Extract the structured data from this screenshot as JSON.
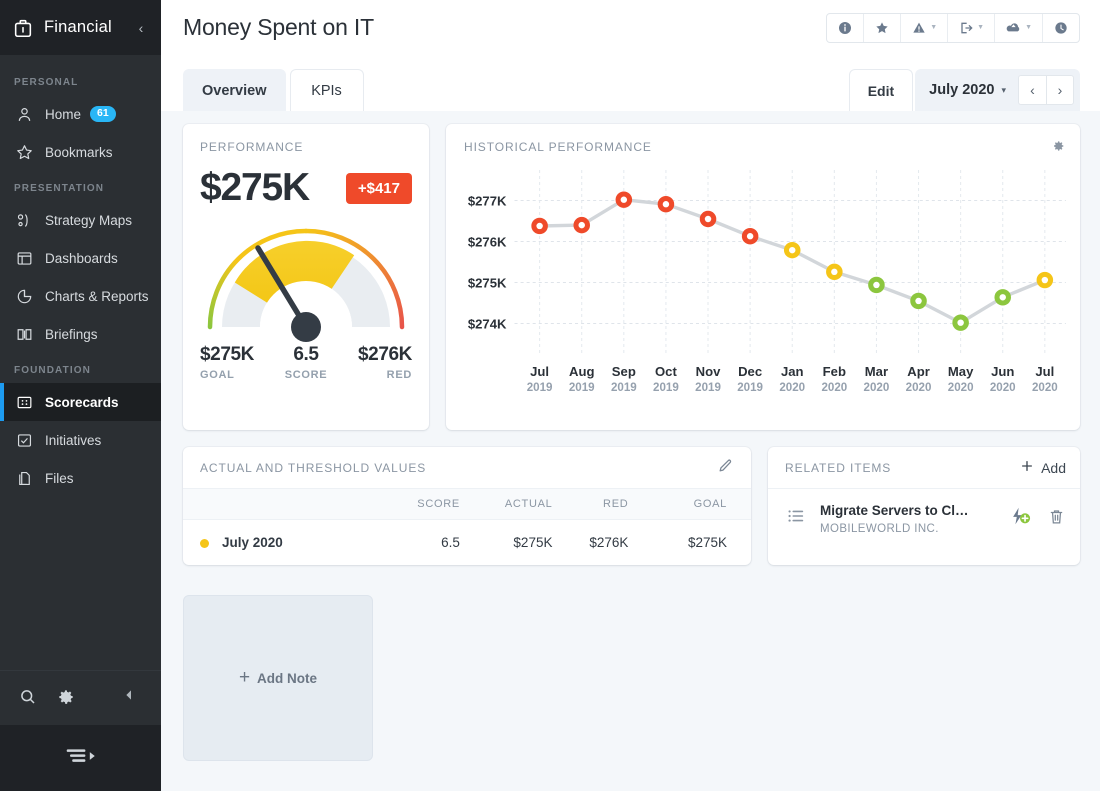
{
  "sidebar": {
    "brand": {
      "label": "Financial",
      "icon": "briefcase-icon",
      "collapse_icon": "chevron-left-icon"
    },
    "sections": [
      {
        "label": "PERSONAL",
        "items": [
          {
            "label": "Home",
            "icon": "user-icon",
            "badge": "61",
            "active": false
          },
          {
            "label": "Bookmarks",
            "icon": "star-outline-icon",
            "badge": "",
            "active": false
          }
        ]
      },
      {
        "label": "PRESENTATION",
        "items": [
          {
            "label": "Strategy Maps",
            "icon": "strategy-map-icon",
            "badge": "",
            "active": false
          },
          {
            "label": "Dashboards",
            "icon": "dashboard-icon",
            "badge": "",
            "active": false
          },
          {
            "label": "Charts & Reports",
            "icon": "pie-chart-icon",
            "badge": "",
            "active": false
          },
          {
            "label": "Briefings",
            "icon": "book-icon",
            "badge": "",
            "active": false
          }
        ]
      },
      {
        "label": "FOUNDATION",
        "items": [
          {
            "label": "Scorecards",
            "icon": "scorecard-icon",
            "badge": "",
            "active": true
          },
          {
            "label": "Initiatives",
            "icon": "checkbox-icon",
            "badge": "",
            "active": false
          },
          {
            "label": "Files",
            "icon": "file-icon",
            "badge": "",
            "active": false
          }
        ]
      }
    ],
    "footer": {
      "search_icon": "search-icon",
      "settings_icon": "gear-icon",
      "collapse_icon": "caret-left-icon"
    },
    "bottom_bar": {
      "icon": "menu-expand-icon"
    }
  },
  "header": {
    "title": "Money Spent on IT",
    "tools": [
      {
        "name": "info-icon",
        "caret": false
      },
      {
        "name": "star-icon",
        "caret": false
      },
      {
        "name": "alert-icon",
        "caret": true
      },
      {
        "name": "export-icon",
        "caret": true
      },
      {
        "name": "cloud-upload-icon",
        "caret": true
      },
      {
        "name": "history-clock-icon",
        "caret": false
      }
    ]
  },
  "tabs": [
    {
      "label": "Overview",
      "active": true
    },
    {
      "label": "KPIs",
      "active": false
    }
  ],
  "toolbar": {
    "edit_label": "Edit",
    "period_label": "July 2020",
    "period_caret": "▾",
    "prev_label": "‹",
    "next_label": "›"
  },
  "performance": {
    "card_title": "PERFORMANCE",
    "value": "$275K",
    "delta": "+$417",
    "delta_color": "#ef4a2a",
    "gauge": {
      "needle_value": 6.5,
      "band_colors": {
        "green": "#a5cd39",
        "yellow": "#f5c518",
        "red": "#e8544a"
      }
    },
    "stats": [
      {
        "value": "$275K",
        "label": "GOAL"
      },
      {
        "value": "6.5",
        "label": "SCORE"
      },
      {
        "value": "$276K",
        "label": "RED"
      }
    ]
  },
  "chart_card": {
    "title": "HISTORICAL PERFORMANCE",
    "gear_icon": "gear-icon"
  },
  "chart_data": {
    "type": "line",
    "title": "Historical Performance",
    "xlabel": "",
    "ylabel": "",
    "ylim": [
      273.5,
      277.55
    ],
    "yticks": [
      277,
      276,
      275,
      274
    ],
    "ytick_labels": [
      "$277K",
      "$276K",
      "$275K",
      "$274K"
    ],
    "grid": true,
    "legend": "none",
    "categories": [
      "Jul 2019",
      "Aug 2019",
      "Sep 2019",
      "Oct 2019",
      "Nov 2019",
      "Dec 2019",
      "Jan 2020",
      "Feb 2020",
      "Mar 2020",
      "Apr 2020",
      "May 2020",
      "Jun 2020",
      "Jul 2020"
    ],
    "category_months": [
      "Jul",
      "Aug",
      "Sep",
      "Oct",
      "Nov",
      "Dec",
      "Jan",
      "Feb",
      "Mar",
      "Apr",
      "May",
      "Jun",
      "Jul"
    ],
    "category_years": [
      "2019",
      "2019",
      "2019",
      "2019",
      "2019",
      "2019",
      "2020",
      "2020",
      "2020",
      "2020",
      "2020",
      "2020",
      "2020"
    ],
    "series": [
      {
        "name": "Actual",
        "values": [
          276.38,
          276.4,
          277.02,
          276.91,
          276.55,
          276.13,
          275.79,
          275.26,
          274.94,
          274.55,
          274.02,
          274.64,
          275.06
        ],
        "point_colors": [
          "#ef4a2a",
          "#ef4a2a",
          "#ef4a2a",
          "#ef4a2a",
          "#ef4a2a",
          "#ef4a2a",
          "#f5c518",
          "#f5c518",
          "#8cc63e",
          "#8cc63e",
          "#8cc63e",
          "#8cc63e",
          "#f5c518"
        ],
        "line_color": "#d2d6da"
      }
    ]
  },
  "values_table": {
    "title": "ACTUAL AND THRESHOLD VALUES",
    "edit_icon": "pencil-icon",
    "columns": [
      "",
      "SCORE",
      "ACTUAL",
      "RED",
      "GOAL"
    ],
    "rows": [
      {
        "period": "July 2020",
        "score": "6.5",
        "actual": "$275K",
        "red": "$276K",
        "goal": "$275K",
        "status_color": "#f5c518"
      }
    ]
  },
  "related_items": {
    "title": "RELATED ITEMS",
    "add_label": "Add",
    "add_icon": "plus-icon",
    "items": [
      {
        "name": "Migrate Servers to Cl…",
        "subtitle": "MOBILEWORLD INC.",
        "list_icon": "list-icon",
        "action_icon": "lightning-add-icon",
        "delete_icon": "trash-icon"
      }
    ]
  },
  "note": {
    "add_label": "Add Note",
    "plus": "+"
  }
}
